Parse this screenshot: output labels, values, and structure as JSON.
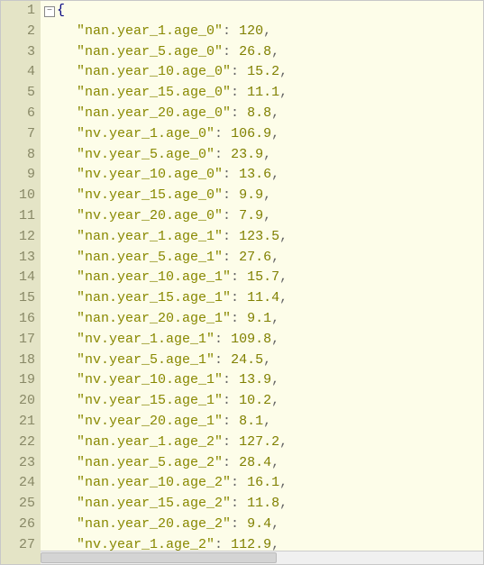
{
  "lines": [
    {
      "num": 1,
      "type": "open"
    },
    {
      "num": 2,
      "type": "kv",
      "key": "nan.year_1.age_0",
      "value": "120",
      "comma": true
    },
    {
      "num": 3,
      "type": "kv",
      "key": "nan.year_5.age_0",
      "value": "26.8",
      "comma": true
    },
    {
      "num": 4,
      "type": "kv",
      "key": "nan.year_10.age_0",
      "value": "15.2",
      "comma": true
    },
    {
      "num": 5,
      "type": "kv",
      "key": "nan.year_15.age_0",
      "value": "11.1",
      "comma": true
    },
    {
      "num": 6,
      "type": "kv",
      "key": "nan.year_20.age_0",
      "value": "8.8",
      "comma": true
    },
    {
      "num": 7,
      "type": "kv",
      "key": "nv.year_1.age_0",
      "value": "106.9",
      "comma": true
    },
    {
      "num": 8,
      "type": "kv",
      "key": "nv.year_5.age_0",
      "value": "23.9",
      "comma": true
    },
    {
      "num": 9,
      "type": "kv",
      "key": "nv.year_10.age_0",
      "value": "13.6",
      "comma": true
    },
    {
      "num": 10,
      "type": "kv",
      "key": "nv.year_15.age_0",
      "value": "9.9",
      "comma": true
    },
    {
      "num": 11,
      "type": "kv",
      "key": "nv.year_20.age_0",
      "value": "7.9",
      "comma": true
    },
    {
      "num": 12,
      "type": "kv",
      "key": "nan.year_1.age_1",
      "value": "123.5",
      "comma": true
    },
    {
      "num": 13,
      "type": "kv",
      "key": "nan.year_5.age_1",
      "value": "27.6",
      "comma": true
    },
    {
      "num": 14,
      "type": "kv",
      "key": "nan.year_10.age_1",
      "value": "15.7",
      "comma": true
    },
    {
      "num": 15,
      "type": "kv",
      "key": "nan.year_15.age_1",
      "value": "11.4",
      "comma": true
    },
    {
      "num": 16,
      "type": "kv",
      "key": "nan.year_20.age_1",
      "value": "9.1",
      "comma": true
    },
    {
      "num": 17,
      "type": "kv",
      "key": "nv.year_1.age_1",
      "value": "109.8",
      "comma": true
    },
    {
      "num": 18,
      "type": "kv",
      "key": "nv.year_5.age_1",
      "value": "24.5",
      "comma": true
    },
    {
      "num": 19,
      "type": "kv",
      "key": "nv.year_10.age_1",
      "value": "13.9",
      "comma": true
    },
    {
      "num": 20,
      "type": "kv",
      "key": "nv.year_15.age_1",
      "value": "10.2",
      "comma": true
    },
    {
      "num": 21,
      "type": "kv",
      "key": "nv.year_20.age_1",
      "value": "8.1",
      "comma": true
    },
    {
      "num": 22,
      "type": "kv",
      "key": "nan.year_1.age_2",
      "value": "127.2",
      "comma": true
    },
    {
      "num": 23,
      "type": "kv",
      "key": "nan.year_5.age_2",
      "value": "28.4",
      "comma": true
    },
    {
      "num": 24,
      "type": "kv",
      "key": "nan.year_10.age_2",
      "value": "16.1",
      "comma": true
    },
    {
      "num": 25,
      "type": "kv",
      "key": "nan.year_15.age_2",
      "value": "11.8",
      "comma": true
    },
    {
      "num": 26,
      "type": "kv",
      "key": "nan.year_20.age_2",
      "value": "9.4",
      "comma": true
    },
    {
      "num": 27,
      "type": "kv",
      "key": "nv.year_1.age_2",
      "value": "112.9",
      "comma": true
    }
  ],
  "indent": "    ",
  "fold_glyph": "−",
  "open_brace": "{",
  "quote": "\""
}
